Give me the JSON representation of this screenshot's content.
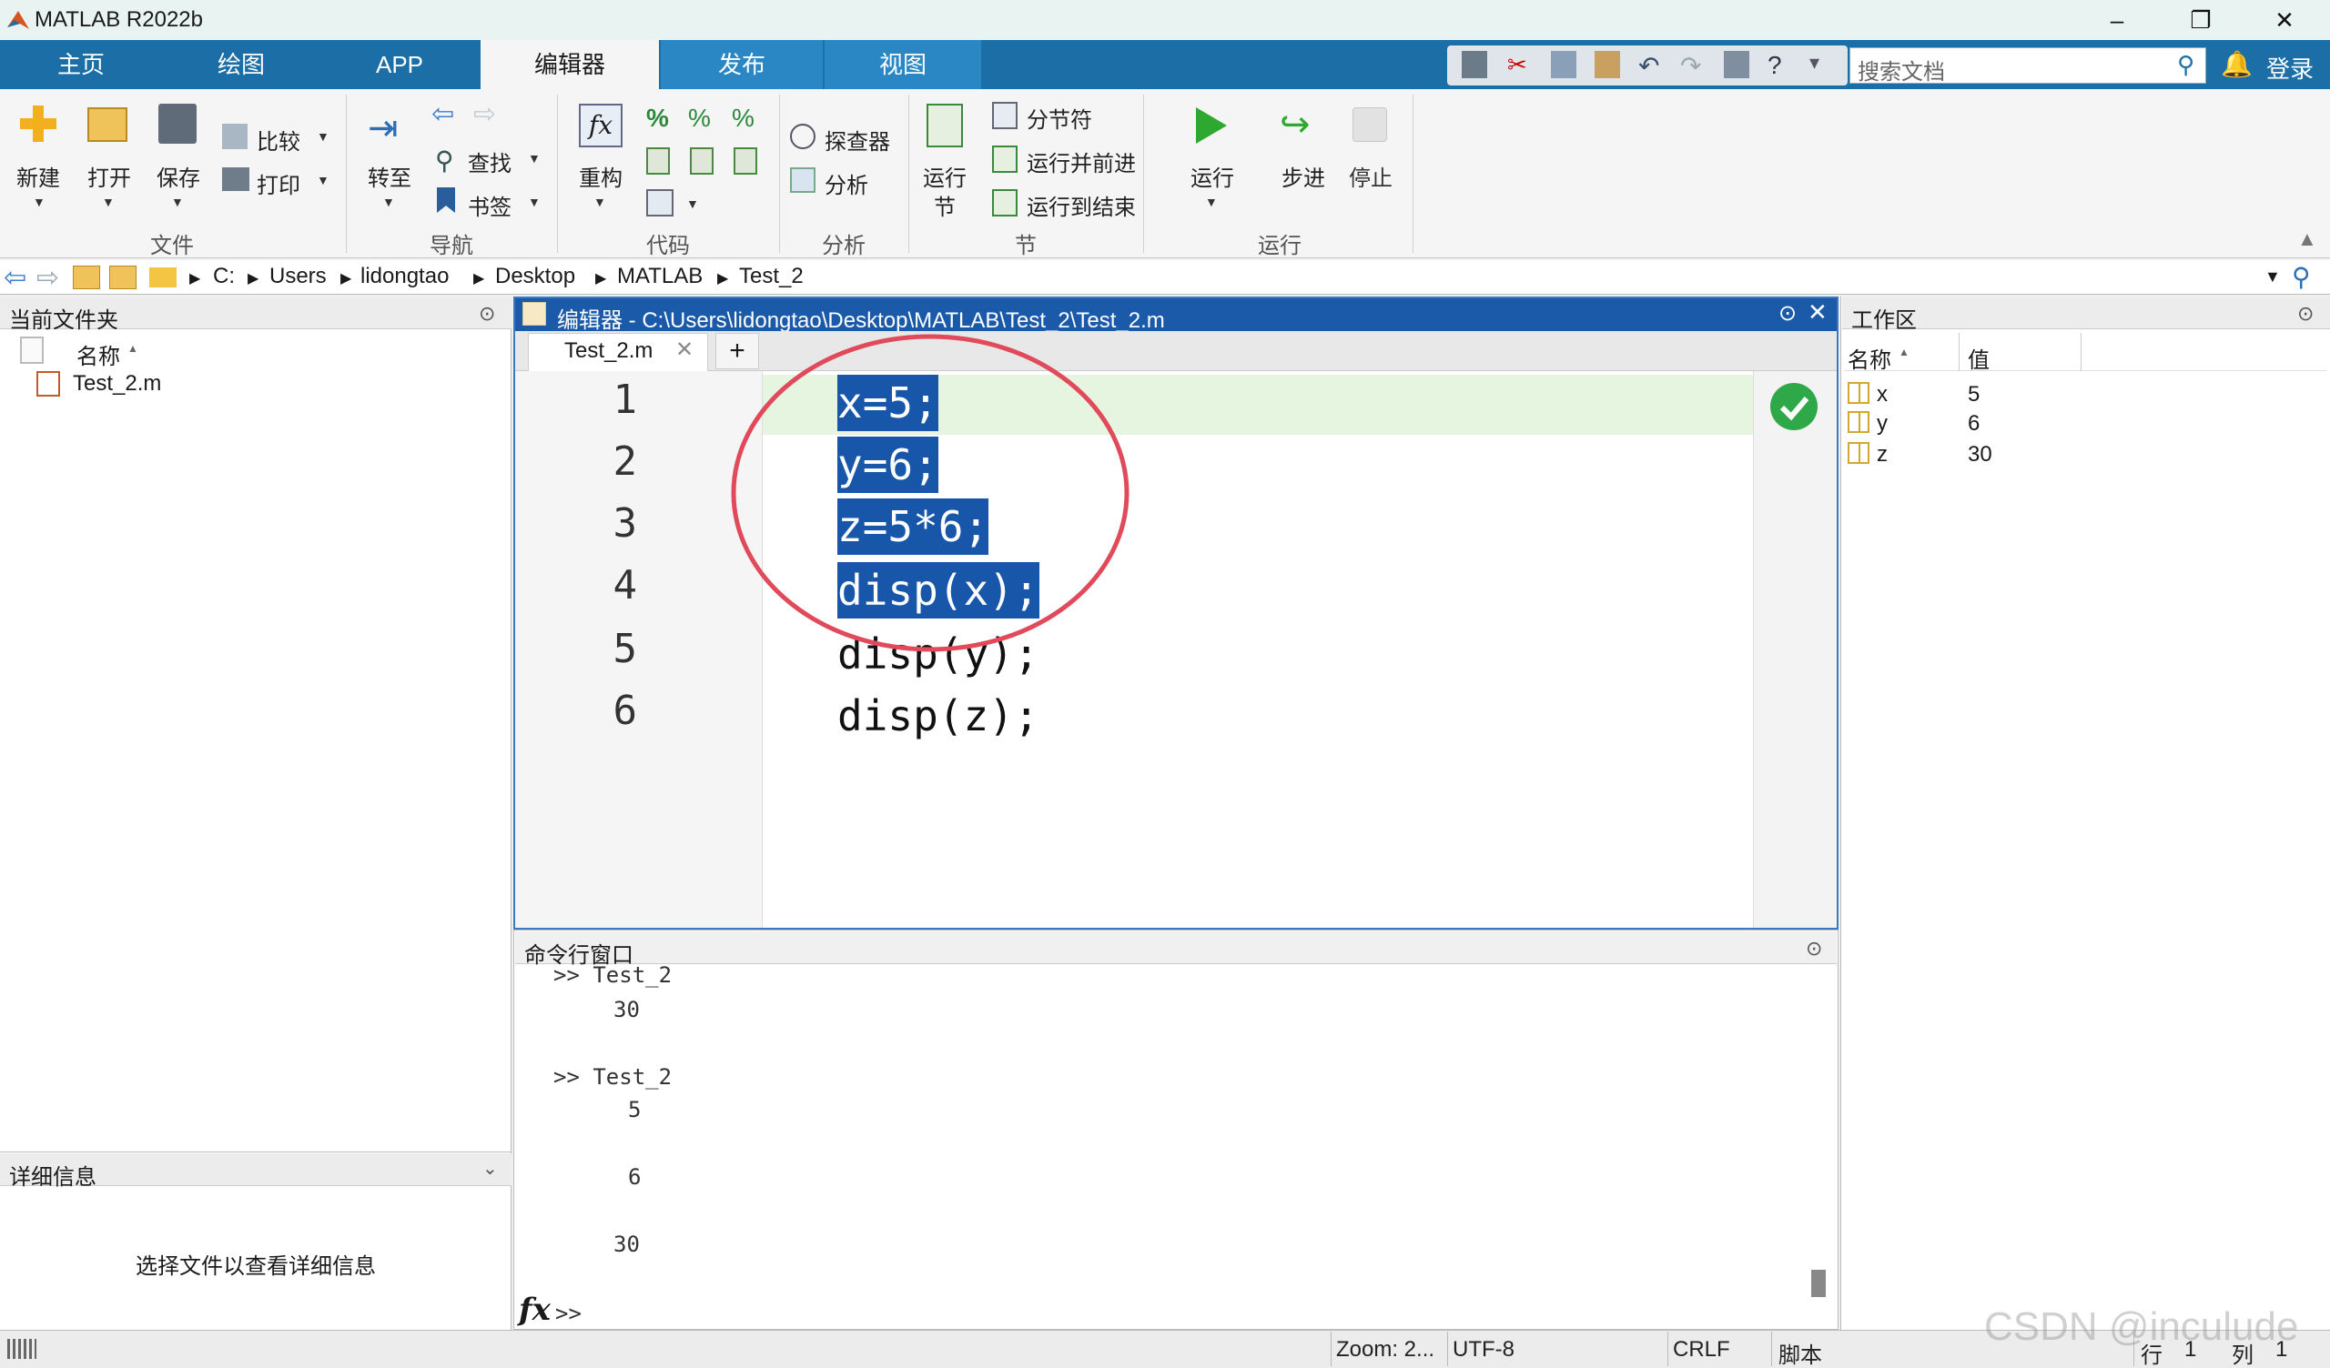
{
  "window": {
    "title": "MATLAB R2022b"
  },
  "ribbon_tabs": [
    "主页",
    "绘图",
    "APP",
    "编辑器",
    "发布",
    "视图"
  ],
  "active_tab": "编辑器",
  "search": {
    "placeholder": "搜索文档"
  },
  "login_label": "登录",
  "ribbon": {
    "file": {
      "label": "文件",
      "new": "新建",
      "open": "打开",
      "save": "保存",
      "compare": "比较",
      "print": "打印"
    },
    "nav": {
      "label": "导航",
      "goto": "转至",
      "find": "查找",
      "bookmark": "书签"
    },
    "code": {
      "label": "代码",
      "refactor": "重构"
    },
    "analyze": {
      "label": "分析",
      "profiler": "探查器",
      "analyze": "分析"
    },
    "section": {
      "label": "节",
      "run_section_1": "运行",
      "run_section_2": "节",
      "section_break": "分节符",
      "run_advance": "运行并前进",
      "run_to_end": "运行到结束"
    },
    "run": {
      "label": "运行",
      "run": "运行",
      "step": "步进",
      "stop": "停止"
    }
  },
  "address": {
    "drive": "C:",
    "parts": [
      "Users",
      "lidongtao",
      "Desktop",
      "MATLAB",
      "Test_2"
    ]
  },
  "current_folder": {
    "title": "当前文件夹",
    "col_name": "名称",
    "files": [
      "Test_2.m"
    ]
  },
  "details": {
    "title": "详细信息",
    "hint": "选择文件以查看详细信息"
  },
  "editor": {
    "title": "编辑器 - C:\\Users\\lidongtao\\Desktop\\MATLAB\\Test_2\\Test_2.m",
    "tab": "Test_2.m",
    "add_tab": "+",
    "lines": [
      {
        "n": "1",
        "code": "x=5;",
        "selected": true
      },
      {
        "n": "2",
        "code": "y=6;",
        "selected": true
      },
      {
        "n": "3",
        "code": "z=5*6;",
        "selected": true
      },
      {
        "n": "4",
        "code": "disp(x);",
        "selected": true
      },
      {
        "n": "5",
        "code": "disp(y);",
        "selected": false
      },
      {
        "n": "6",
        "code": "disp(z);",
        "selected": false
      }
    ]
  },
  "command_window": {
    "title": "命令行窗口",
    "lines": [
      ">> Test_2",
      "30",
      ">> Test_2",
      "5",
      "6",
      "30"
    ],
    "prompt": ">>",
    "fx": "fx"
  },
  "workspace": {
    "title": "工作区",
    "col_name": "名称",
    "col_value": "值",
    "vars": [
      {
        "name": "x",
        "value": "5"
      },
      {
        "name": "y",
        "value": "6"
      },
      {
        "name": "z",
        "value": "30"
      }
    ]
  },
  "status": {
    "zoom": "Zoom: 2...",
    "encoding": "UTF-8",
    "eol": "CRLF",
    "type": "脚本",
    "row_label": "行",
    "row": "1",
    "col_label": "列",
    "col": "1"
  },
  "watermark": "CSDN @inculude",
  "colors": {
    "tab_strip": "#1b6fa6",
    "selection": "#1756a9",
    "annotation_circle": "#e04a5a",
    "current_line": "#e6f5e0"
  }
}
